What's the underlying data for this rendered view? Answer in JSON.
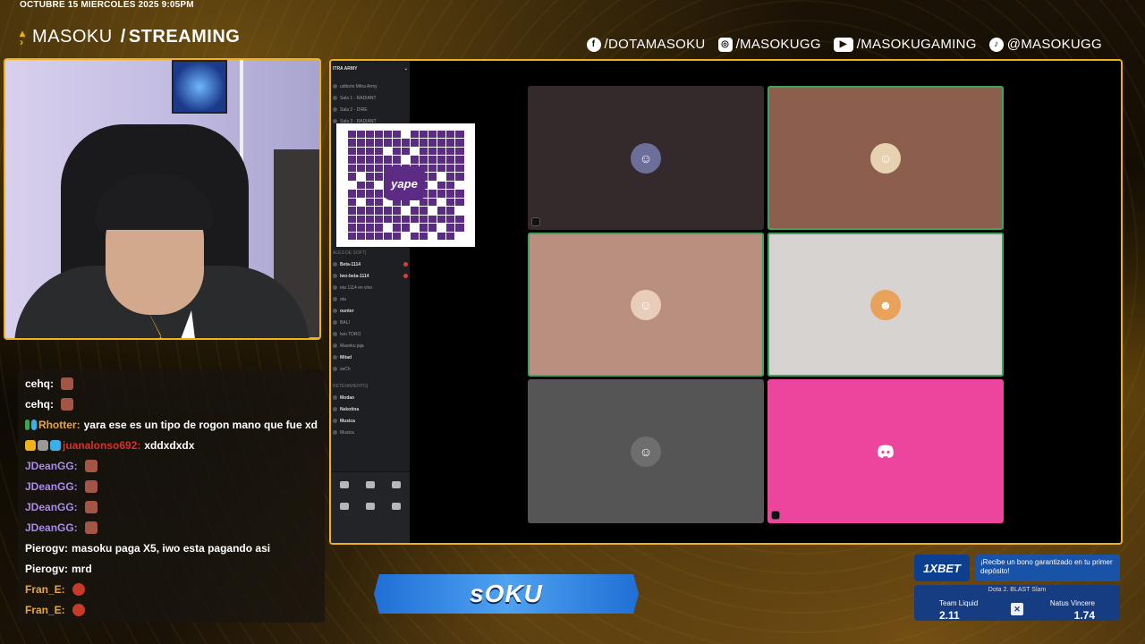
{
  "top": {
    "date": "OCTUBRE 15 MIERCOLES 2025 9:05PM",
    "brand_name": "MASOKU",
    "brand_slash": "/",
    "brand_section": "STREAMING",
    "socials": [
      {
        "icon": "facebook-icon",
        "glyph": "f",
        "text": "/DOTAMASOKU"
      },
      {
        "icon": "instagram-icon",
        "glyph": "◎",
        "text": "/MASOKUGG"
      },
      {
        "icon": "youtube-icon",
        "glyph": "▶",
        "text": "/MASOKUGAMING"
      },
      {
        "icon": "tiktok-icon",
        "glyph": "♪",
        "text": "@MASOKUGG"
      }
    ]
  },
  "chat": {
    "messages": [
      {
        "user": "cehq:",
        "color": "#ffffff",
        "text": "",
        "emote": "brown",
        "badges": []
      },
      {
        "user": "cehq:",
        "color": "#ffffff",
        "text": "",
        "emote": "brown",
        "badges": []
      },
      {
        "user": "Rhotter:",
        "color": "#e8a640",
        "text": "yara ese es un tipo de rogon mano que fue xd",
        "emote": "",
        "badges": [
          "#3aa84a",
          "#3ab0e8"
        ]
      },
      {
        "user": "juanalonso692:",
        "color": "#d8302a",
        "text": "xddxdxdx",
        "emote": "",
        "badges": [
          "#f0b21a",
          "#999999",
          "#3ab0e8"
        ]
      },
      {
        "user": "JDeanGG:",
        "color": "#a98ce8",
        "text": "",
        "emote": "brown",
        "badges": []
      },
      {
        "user": "JDeanGG:",
        "color": "#a98ce8",
        "text": "",
        "emote": "brown",
        "badges": []
      },
      {
        "user": "JDeanGG:",
        "color": "#a98ce8",
        "text": "",
        "emote": "brown",
        "badges": []
      },
      {
        "user": "JDeanGG:",
        "color": "#a98ce8",
        "text": "",
        "emote": "brown",
        "badges": []
      },
      {
        "user": "Pierogv:",
        "color": "#ffffff",
        "text": "masoku paga X5, iwo esta pagando asi",
        "emote": "",
        "badges": []
      },
      {
        "user": "Pierogv:",
        "color": "#ffffff",
        "text": "mrd",
        "emote": "",
        "badges": []
      },
      {
        "user": "Fran_E:",
        "color": "#e8a640",
        "text": "",
        "emote": "red",
        "badges": []
      },
      {
        "user": "Fran_E:",
        "color": "#e8a640",
        "text": "",
        "emote": "red",
        "badges": []
      }
    ]
  },
  "discord": {
    "server": "ITRA ARMY",
    "channels": [
      {
        "label": "uditorio Mitra Army",
        "style": "",
        "ping": false,
        "cat": false
      },
      {
        "label": "Sala 1 - RADIANT",
        "style": "",
        "ping": false,
        "cat": false
      },
      {
        "label": "Sala 2 - DIRE",
        "style": "",
        "ping": false,
        "cat": false
      },
      {
        "label": "Sala 3 - RADIANT",
        "style": "",
        "ping": false,
        "cat": false
      }
    ],
    "channels_lower": [
      {
        "label": "ALES DE SOFT]",
        "style": "cat",
        "ping": false
      },
      {
        "label": "Beta-1114",
        "style": "b",
        "ping": true
      },
      {
        "label": "Iwo-beta-1114",
        "style": "b",
        "ping": true
      },
      {
        "label": "eta 1114 en vivo",
        "style": "",
        "ping": false
      },
      {
        "label": "ota",
        "style": "",
        "ping": false
      },
      {
        "label": "ounter",
        "style": "b",
        "ping": false
      },
      {
        "label": "BALI",
        "style": "",
        "ping": false
      },
      {
        "label": "Iwo TORO",
        "style": "",
        "ping": false
      },
      {
        "label": "Masoku jaja",
        "style": "",
        "ping": false
      },
      {
        "label": "Mitad",
        "style": "b",
        "ping": false
      },
      {
        "label": "zeCh",
        "style": "",
        "ping": false
      },
      {
        "label": "RETENIMIENTO]",
        "style": "cat",
        "ping": false
      },
      {
        "label": "Modao",
        "style": "b",
        "ping": false
      },
      {
        "label": "Nekotina",
        "style": "b",
        "ping": false
      },
      {
        "label": "Musica",
        "style": "b",
        "ping": false
      },
      {
        "label": "Musica",
        "style": "",
        "ping": false
      }
    ],
    "qr_logo_text": "yape",
    "tiles": [
      {
        "bg": "#34292b",
        "avatar_bg": "#6b6f9a",
        "avatar": "☺",
        "speaking": false
      },
      {
        "bg": "#8c5e4d",
        "avatar_bg": "#e6d2b0",
        "avatar": "☺",
        "speaking": true
      },
      {
        "bg": "#b99080",
        "avatar_bg": "#e9cdbb",
        "avatar": "☺",
        "speaking": true
      },
      {
        "bg": "#d6d3d0",
        "avatar_bg": "#e9a25a",
        "avatar": "☻",
        "speaking": true
      },
      {
        "bg": "#555555",
        "avatar_bg": "#6e6e6e",
        "avatar": "☺",
        "speaking": false
      },
      {
        "bg": "#eb459e",
        "avatar_bg": "#eb459e",
        "avatar": "discord-icon",
        "speaking": false
      }
    ]
  },
  "banner": {
    "text": "sOKU"
  },
  "bet": {
    "brand": "1XBET",
    "promo": "¡Recibe un bono garantizado en tu primer depósito!",
    "event": "Dota 2. BLAST Slam",
    "team1": "Team Liquid",
    "odds1": "2.11",
    "team2": "Natus Vincere",
    "odds2": "1.74"
  }
}
